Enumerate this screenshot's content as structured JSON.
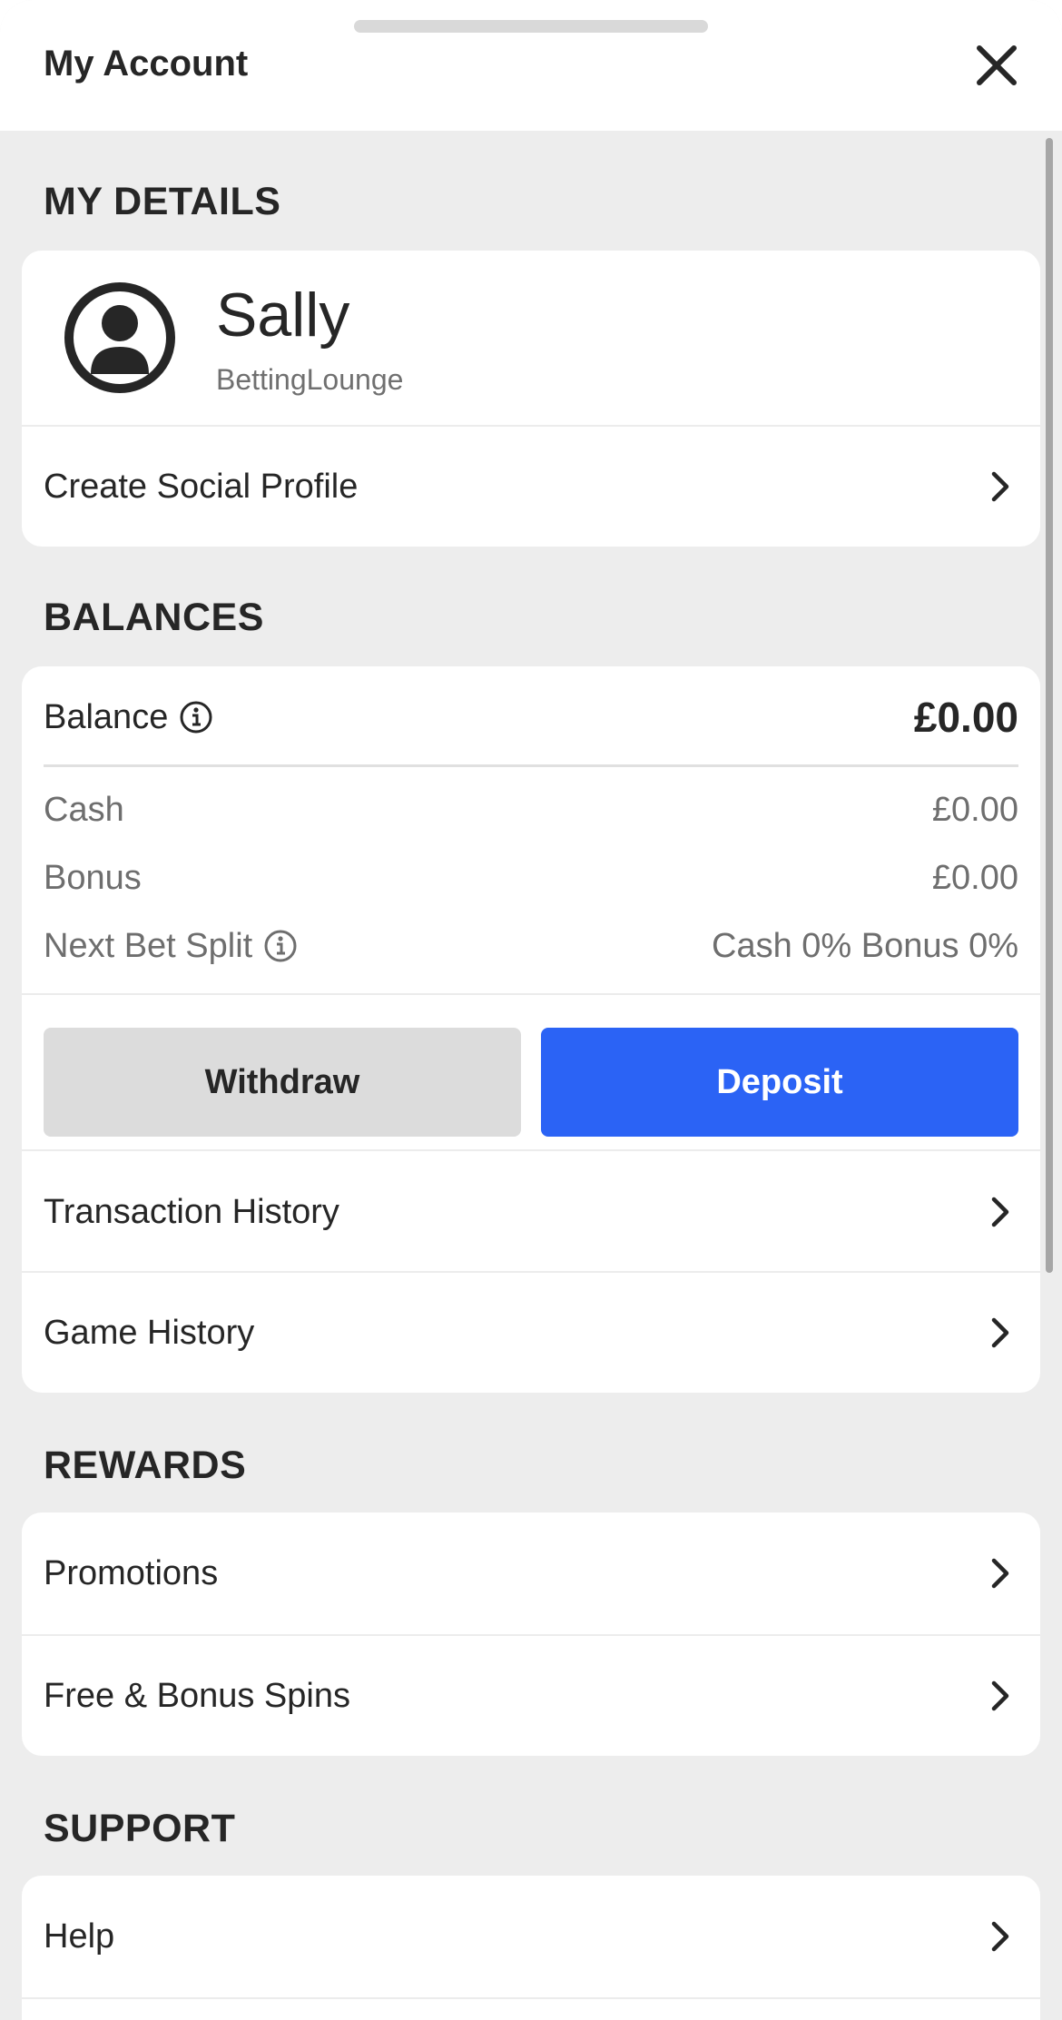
{
  "header": {
    "title": "My Account"
  },
  "my_details": {
    "section_title": "MY DETAILS",
    "user_name": "Sally",
    "brand_name": "BettingLounge",
    "create_social_profile": "Create Social Profile"
  },
  "balances": {
    "section_title": "BALANCES",
    "balance_label": "Balance",
    "balance_value": "£0.00",
    "cash_label": "Cash",
    "cash_value": "£0.00",
    "bonus_label": "Bonus",
    "bonus_value": "£0.00",
    "next_bet_split_label": "Next Bet Split",
    "next_bet_split_value": "Cash 0% Bonus 0%",
    "withdraw_label": "Withdraw",
    "deposit_label": "Deposit",
    "transaction_history": "Transaction History",
    "game_history": "Game History"
  },
  "rewards": {
    "section_title": "REWARDS",
    "promotions": "Promotions",
    "free_bonus_spins": "Free & Bonus Spins"
  },
  "support": {
    "section_title": "SUPPORT",
    "help": "Help"
  },
  "colors": {
    "accent": "#2b63f5",
    "background": "#ededed",
    "card": "#ffffff",
    "text": "#262626",
    "muted_text": "#6e6e6e"
  },
  "icons": [
    "close-icon",
    "user-avatar-icon",
    "info-icon",
    "chevron-right-icon"
  ]
}
